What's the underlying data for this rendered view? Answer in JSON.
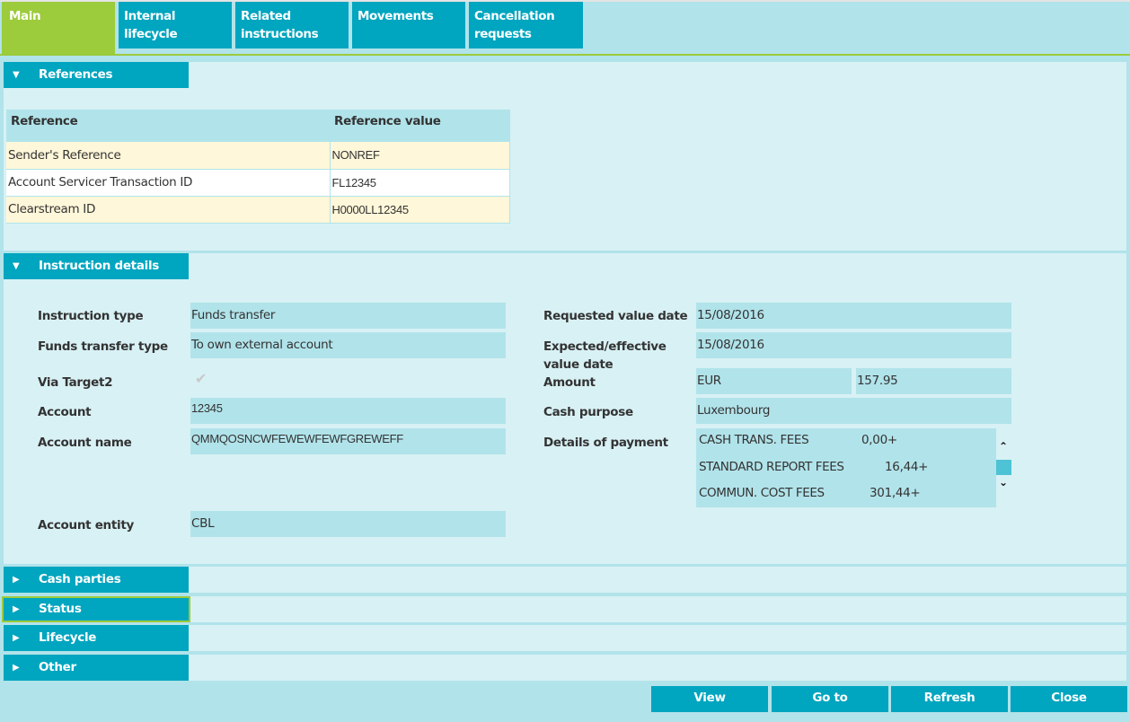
{
  "tabs": [
    {
      "label": "Main",
      "active": true
    },
    {
      "label": "Internal lifecycle",
      "active": false
    },
    {
      "label": "Related instructions",
      "active": false
    },
    {
      "label": "Movements",
      "active": false
    },
    {
      "label": "Cancellation requests",
      "active": false
    }
  ],
  "references": {
    "header": "References",
    "expanded": true,
    "columns": [
      "Reference",
      "Reference value"
    ],
    "rows": [
      {
        "reference": "Sender's Reference",
        "value": "NONREF"
      },
      {
        "reference": "Account Servicer Transaction ID",
        "value": "FL12345"
      },
      {
        "reference": "Clearstream ID",
        "value": "H0000LL12345"
      }
    ]
  },
  "instruction_details": {
    "header": "Instruction details",
    "expanded": true,
    "left": {
      "instruction_type": {
        "label": "Instruction type",
        "value": "Funds transfer"
      },
      "funds_transfer_type": {
        "label": "Funds transfer type",
        "value": "To own external account"
      },
      "via_target2": {
        "label": "Via Target2",
        "checked": true
      },
      "account": {
        "label": "Account",
        "value": "12345"
      },
      "account_name": {
        "label": "Account name",
        "value": "QMMQOSNCWFEWEWFEWFGREWEFF"
      },
      "account_entity": {
        "label": "Account entity",
        "value": "CBL"
      }
    },
    "right": {
      "requested_value_date": {
        "label": "Requested value date",
        "value": "15/08/2016"
      },
      "expected_value_date": {
        "label": "Expected/effective value date",
        "value": "15/08/2016"
      },
      "amount": {
        "label": "Amount",
        "currency": "EUR",
        "value": "157.95"
      },
      "cash_purpose": {
        "label": "Cash purpose",
        "value": "Luxembourg"
      },
      "details_of_payment": {
        "label": "Details of payment",
        "lines": [
          {
            "text": "CASH TRANS. FEES",
            "amount": "0,00+"
          },
          {
            "text": "STANDARD REPORT FEES",
            "amount": "16,44+"
          },
          {
            "text": "COMMUN. COST FEES",
            "amount": "301,44+"
          }
        ]
      }
    }
  },
  "collapsed_sections": [
    {
      "label": "Cash parties",
      "expanded": false
    },
    {
      "label": "Status",
      "expanded": false,
      "focused": true
    },
    {
      "label": "Lifecycle",
      "expanded": false
    },
    {
      "label": "Other",
      "expanded": false
    }
  ],
  "icons": {
    "expanded": "▼",
    "collapsed": "▶",
    "check": "✔",
    "scroll_up": "⌃",
    "scroll_down": "⌄"
  },
  "buttons": {
    "view": "View",
    "goto": "Go to",
    "refresh": "Refresh",
    "close": "Close"
  },
  "colors": {
    "accent": "#00a5bf",
    "active_tab": "#9ccb3b",
    "panel": "#d8f1f5",
    "field": "#b1e3ea",
    "row_highlight": "#fff7d9"
  }
}
